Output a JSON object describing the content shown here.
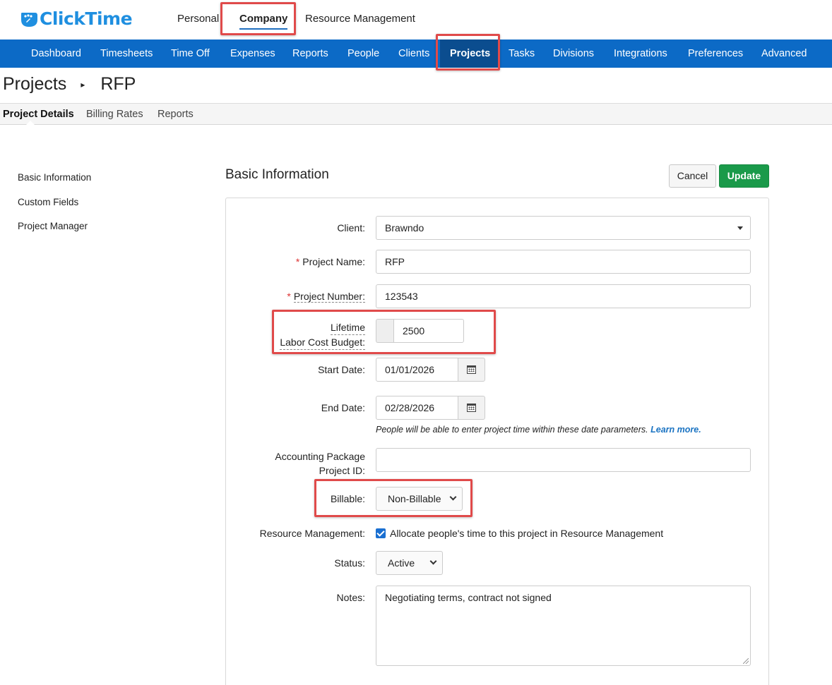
{
  "brand": {
    "name": "ClickTime",
    "color": "#1f8fe0"
  },
  "app_tabs": [
    {
      "label": "Personal"
    },
    {
      "label": "Company",
      "active": true
    },
    {
      "label": "Resource Management"
    }
  ],
  "nav": {
    "color": "#0c6ac6",
    "items": [
      {
        "label": "Dashboard"
      },
      {
        "label": "Timesheets"
      },
      {
        "label": "Time Off"
      },
      {
        "label": "Expenses"
      },
      {
        "label": "Reports"
      },
      {
        "label": "People"
      },
      {
        "label": "Clients"
      },
      {
        "label": "Projects",
        "active": true
      },
      {
        "label": "Tasks"
      },
      {
        "label": "Divisions"
      },
      {
        "label": "Integrations"
      },
      {
        "label": "Preferences"
      },
      {
        "label": "Advanced"
      }
    ]
  },
  "breadcrumb": {
    "root": "Projects",
    "separator": "▸",
    "current": "RFP"
  },
  "subtabs": [
    {
      "label": "Project Details",
      "active": true
    },
    {
      "label": "Billing Rates"
    },
    {
      "label": "Reports"
    }
  ],
  "sidenav": [
    "Basic Information",
    "Custom Fields",
    "Project Manager"
  ],
  "section": {
    "title": "Basic Information",
    "cancel_label": "Cancel",
    "update_label": "Update",
    "update_color": "#1a9a4a"
  },
  "form": {
    "client": {
      "label": "Client:",
      "value": "Brawndo"
    },
    "project_name": {
      "required": "*",
      "label": "Project Name:",
      "value": "RFP"
    },
    "project_number": {
      "required": "*",
      "label": "Project Number:",
      "value": "123543"
    },
    "budget": {
      "label_line1": "Lifetime",
      "label_line2": "Labor Cost Budget:",
      "value": "2500"
    },
    "start_date": {
      "label": "Start Date:",
      "value": "01/01/2026"
    },
    "end_date": {
      "label": "End Date:",
      "value": "02/28/2026"
    },
    "date_hint": {
      "text": "People will be able to enter project time within these date parameters.",
      "link": "Learn more."
    },
    "accounting": {
      "label_line1": "Accounting Package",
      "label_line2": "Project ID:",
      "value": ""
    },
    "billable": {
      "label": "Billable:",
      "value": "Non-Billable"
    },
    "resource_mgmt": {
      "label": "Resource Management:",
      "checked": true,
      "text": "Allocate people's time to this project in Resource Management"
    },
    "status": {
      "label": "Status:",
      "value": "Active"
    },
    "notes": {
      "label": "Notes:",
      "value": "Negotiating terms, contract not signed"
    }
  },
  "highlight_color": "#e04a4a"
}
